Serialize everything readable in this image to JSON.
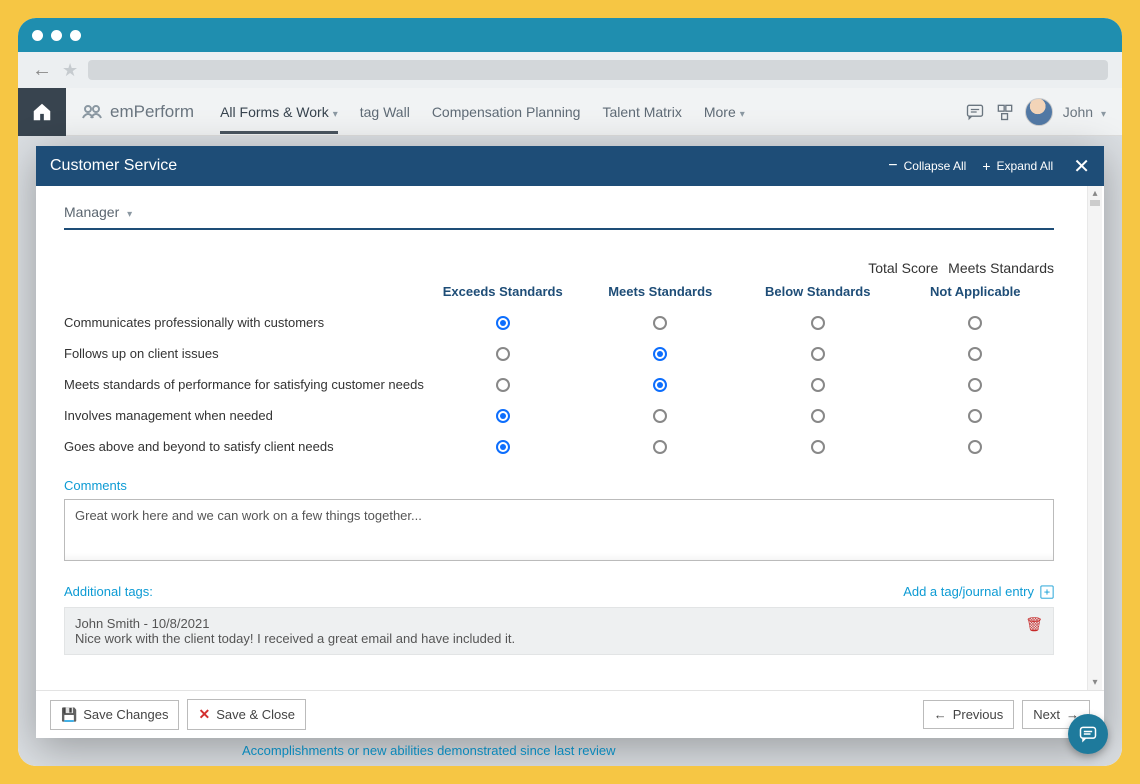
{
  "brand": "emPerform",
  "nav": {
    "items": [
      "All Forms & Work",
      "tag Wall",
      "Compensation Planning",
      "Talent Matrix",
      "More"
    ],
    "active_index": 0
  },
  "user": {
    "name": "John"
  },
  "modal": {
    "title": "Customer Service",
    "collapse": "Collapse All",
    "expand": "Expand All",
    "role": "Manager",
    "total_score": {
      "label": "Total Score",
      "value": "Meets Standards"
    },
    "columns": [
      "Exceeds Standards",
      "Meets Standards",
      "Below Standards",
      "Not Applicable"
    ],
    "criteria": [
      {
        "label": "Communicates professionally with customers",
        "selected": 0
      },
      {
        "label": "Follows up on client issues",
        "selected": 1
      },
      {
        "label": "Meets standards of performance for satisfying customer needs",
        "selected": 1
      },
      {
        "label": "Involves management when needed",
        "selected": 0
      },
      {
        "label": "Goes above and beyond to satisfy client needs",
        "selected": 0
      }
    ],
    "comments_label": "Comments",
    "comments_value": "Great work here and we can work on a few things together...",
    "tags_label": "Additional tags:",
    "add_tag": "Add a tag/journal entry",
    "tag_entry": {
      "author_date": "John Smith - 10/8/2021",
      "text": "Nice work with the client today! I received a great email and have included it."
    },
    "buttons": {
      "save": "Save Changes",
      "save_close": "Save & Close",
      "prev": "Previous",
      "next": "Next"
    }
  },
  "background_hint": "Accomplishments or new abilities demonstrated since last review"
}
